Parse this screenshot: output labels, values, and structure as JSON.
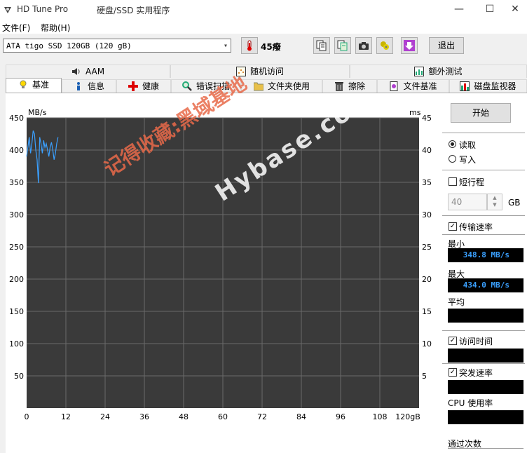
{
  "window": {
    "app_title": "HD Tune Pro",
    "subtitle": "硬盘/SSD 实用程序",
    "minimize": "—",
    "maximize": "☐",
    "close": "✕"
  },
  "menu": {
    "file": "文件(F)",
    "help": "帮助(H)"
  },
  "toolbar": {
    "drive": "ATA     tigo SSD 120GB (120 gB)",
    "temperature": "45癈",
    "exit_label": "退出"
  },
  "tabs_top": [
    {
      "label": "AAM"
    },
    {
      "label": "随机访问"
    },
    {
      "label": "额外测试"
    }
  ],
  "tabs_bottom": [
    {
      "label": "基准"
    },
    {
      "label": "信息"
    },
    {
      "label": "健康"
    },
    {
      "label": "错误扫描"
    },
    {
      "label": "文件夹使用"
    },
    {
      "label": "擦除"
    },
    {
      "label": "文件基准"
    },
    {
      "label": "磁盘监视器"
    }
  ],
  "watermark": {
    "line1": "记得收藏:黑域基地",
    "line2": "Hybase.com"
  },
  "right_panel": {
    "start_label": "开始",
    "read_label": "读取",
    "write_label": "写入",
    "short_stroke_label": "短行程",
    "short_stroke_value": "40",
    "gb_unit": "GB",
    "transfer_rate_label": "传输速率",
    "min_label": "最小",
    "min_value": "348.8 MB/s",
    "max_label": "最大",
    "max_value": "434.0 MB/s",
    "avg_label": "平均",
    "access_time_label": "访问时间",
    "burst_rate_label": "突发速率",
    "cpu_label": "CPU 使用率",
    "passes_label": "通过次数"
  },
  "chart_data": {
    "type": "line",
    "left_unit": "MB/s",
    "right_unit": "ms",
    "y_ticks": [
      "450",
      "400",
      "350",
      "300",
      "250",
      "200",
      "150",
      "100",
      "50"
    ],
    "right_ticks": [
      "45",
      "40",
      "35",
      "30",
      "25",
      "20",
      "15",
      "10",
      "5"
    ],
    "x_ticks": [
      "0",
      "12",
      "24",
      "36",
      "48",
      "60",
      "72",
      "84",
      "96",
      "108",
      "120gB"
    ],
    "xlim": [
      0,
      120
    ],
    "ylim": [
      0,
      450
    ],
    "grid": true,
    "series": [
      {
        "color": "#3aa0ff",
        "x": [
          0,
          0.4,
          0.8,
          1.2,
          1.6,
          2,
          2.4,
          2.8,
          3.2,
          3.6,
          4,
          4.4,
          4.8,
          5.2,
          5.6,
          6,
          6.4,
          6.8,
          7.2,
          7.6,
          8,
          8.4,
          8.8,
          9.2,
          9.6
        ],
        "y": [
          390,
          405,
          420,
          395,
          410,
          430,
          425,
          400,
          385,
          348.8,
          420,
          410,
          395,
          415,
          404,
          410,
          400,
          390,
          405,
          412,
          400,
          385,
          395,
          410,
          420
        ]
      }
    ]
  }
}
